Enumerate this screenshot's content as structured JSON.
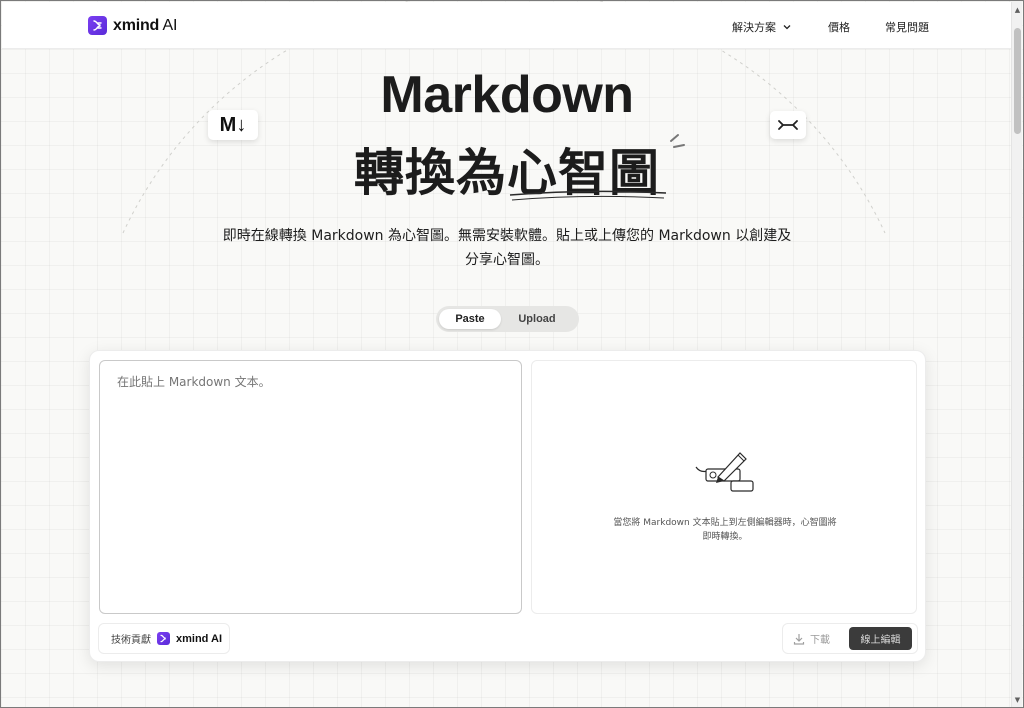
{
  "header": {
    "logo_text": "xmind",
    "logo_ai": " AI",
    "nav": {
      "solutions": "解決方案",
      "pricing": "價格",
      "faq": "常見問題"
    }
  },
  "hero": {
    "title_line1": "Markdown",
    "title_line2": "轉換為心智圖",
    "badge_md": "M↓",
    "subtitle_line1": "即時在線轉換 Markdown 為心智圖。無需安裝軟體。貼上或上傳您的 Markdown 以創建及",
    "subtitle_line2": "分享心智圖。"
  },
  "mode_toggle": {
    "paste_label": "Paste",
    "upload_label": "Upload",
    "selected": "Paste"
  },
  "editor": {
    "placeholder": "在此貼上 Markdown 文本。",
    "value": ""
  },
  "preview": {
    "hint_line1": "當您將 Markdown 文本貼上到左側編輯器時，心智圖將",
    "hint_line2": "即時轉換。"
  },
  "footer_bar": {
    "powered_by": "技術貢獻",
    "powered_brand": "xmind AI",
    "download_label": "下載",
    "edit_online_label": "線上編輯"
  },
  "colors": {
    "brand": "#6b35e8",
    "dark_button": "#3b3b3b",
    "background": "#f9f9f7"
  },
  "icons": [
    "xmind-logo-icon",
    "chevron-down-icon",
    "markdown-icon",
    "mindmap-icon",
    "pencil-illustration-icon",
    "download-icon"
  ]
}
